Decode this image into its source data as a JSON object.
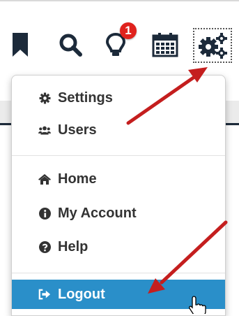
{
  "toolbar": {
    "notifications_badge": "1"
  },
  "menu": {
    "items": [
      {
        "label": "Settings",
        "icon": "gear-icon"
      },
      {
        "label": "Users",
        "icon": "users-icon"
      },
      {
        "label": "Home",
        "icon": "home-icon"
      },
      {
        "label": "My Account",
        "icon": "info-circle-icon"
      },
      {
        "label": "Help",
        "icon": "question-circle-icon"
      },
      {
        "label": "Logout",
        "icon": "sign-out-icon"
      }
    ],
    "active_item": "Logout"
  },
  "colors": {
    "icon_navy": "#1c2a3a",
    "badge_red": "#e0221d",
    "active_blue": "#2a8fc9",
    "arrow_red": "#c41e1e"
  }
}
